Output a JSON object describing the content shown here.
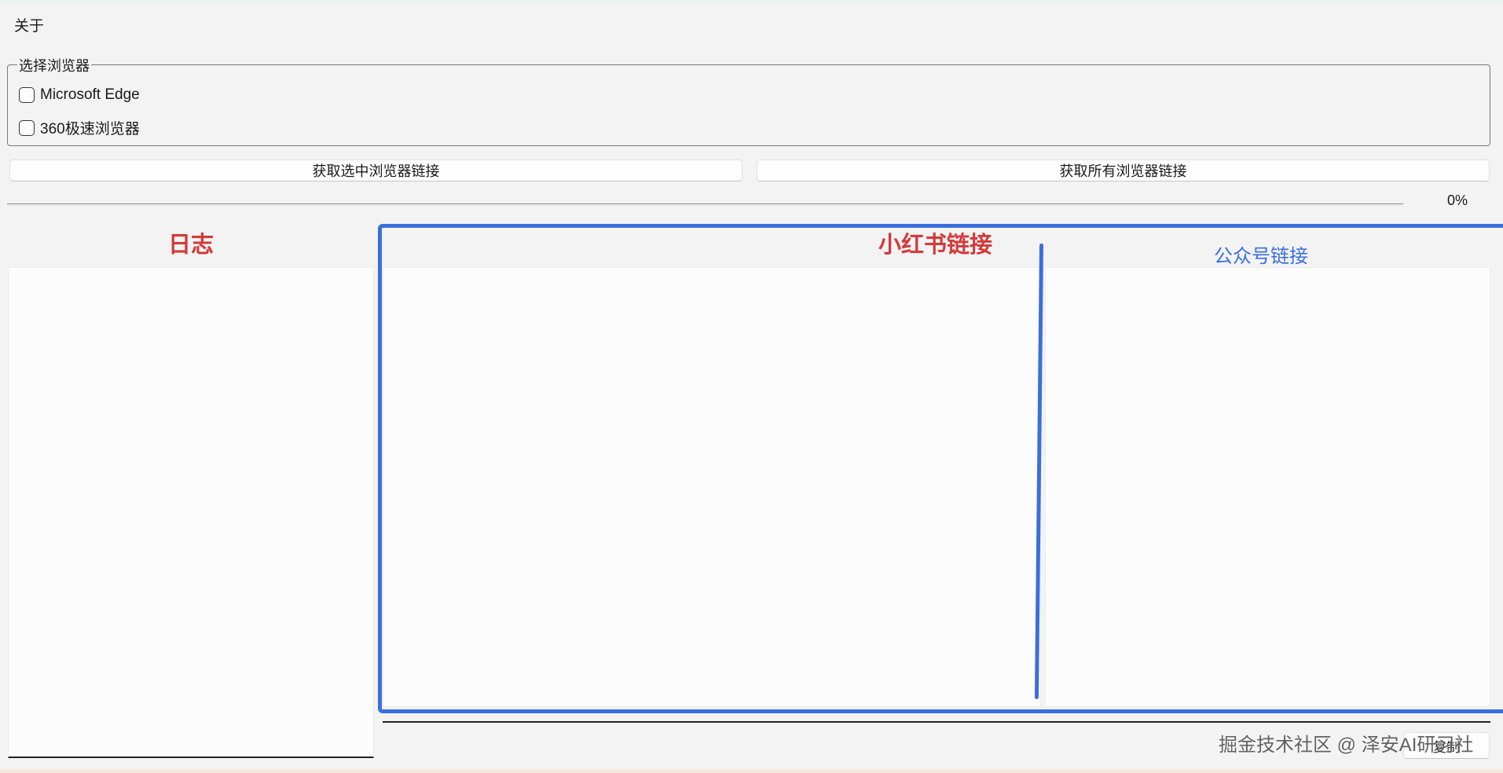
{
  "menu": {
    "about_label": "关于"
  },
  "browser_group": {
    "legend": "选择浏览器",
    "options": [
      {
        "label": "Microsoft Edge",
        "checked": false
      },
      {
        "label": "360极速浏览器",
        "checked": false
      }
    ]
  },
  "buttons": {
    "get_selected_label": "获取选中浏览器链接",
    "get_all_label": "获取所有浏览器链接",
    "copy_label": "复制"
  },
  "progress": {
    "value": 0,
    "text": "0%"
  },
  "annotations": {
    "log_label": "日志",
    "xhs_label": "小红书链接",
    "gzh_label": "公众号链接"
  },
  "watermark": "掘金技术社区 @ 泽安AI研习社",
  "colors": {
    "annotation_red": "#d33a3a",
    "annotation_blue": "#3a6fdc",
    "window_bg": "#f3f3f3"
  }
}
